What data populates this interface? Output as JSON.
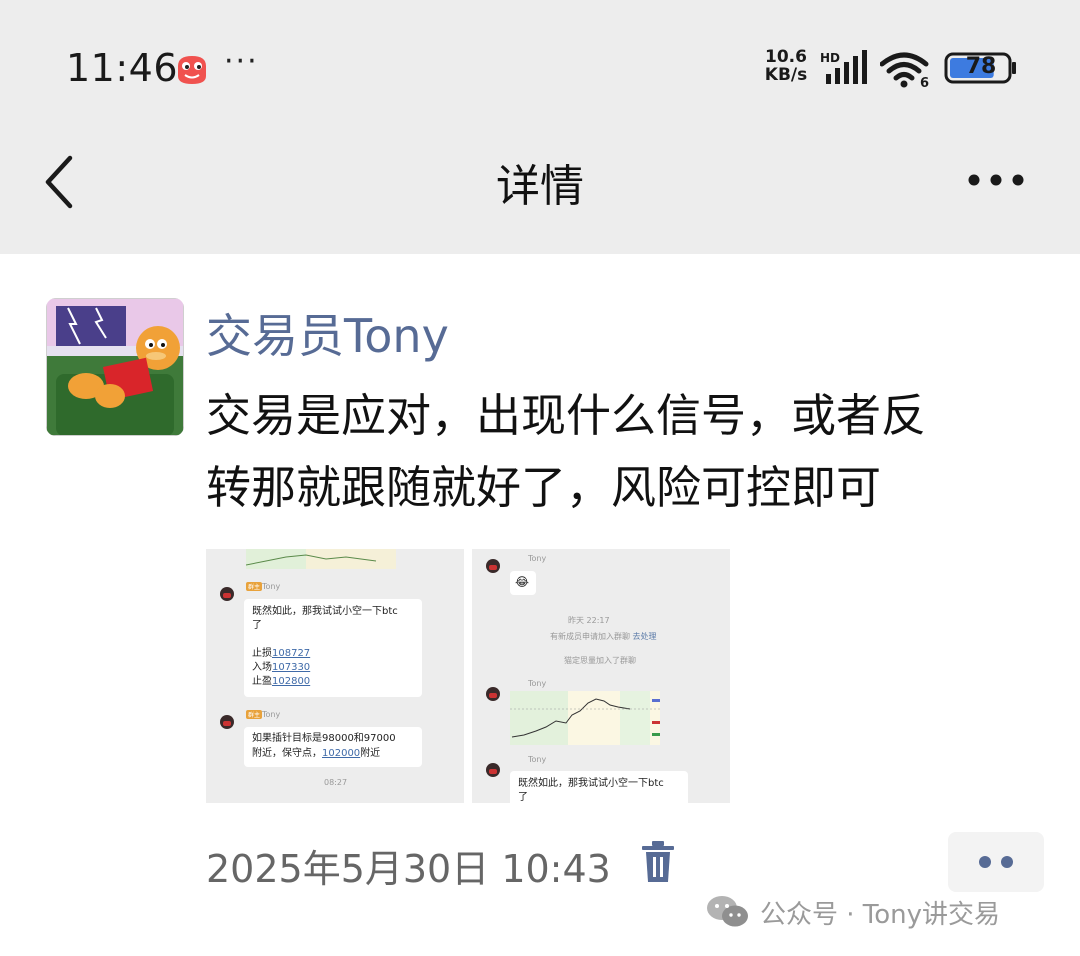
{
  "status_bar": {
    "time": "11:46",
    "overflow": "···",
    "net_speed_value": "10.6",
    "net_speed_unit": "KB/s",
    "signal_label": "HD",
    "wifi_label": "6",
    "battery": "78"
  },
  "header": {
    "title": "详情",
    "back_icon": "chevron-left-icon",
    "more_icon": "more-horizontal-icon"
  },
  "post": {
    "author": "交易员Tony",
    "text_lines": [
      "交易是应对，出现什么信号，或者反",
      "转那就跟随就好了，风险可控即可"
    ],
    "timestamp": "2025年5月30日 10:43",
    "images": [
      {
        "name1": "Tony",
        "tag": "群主",
        "msg1_line1": "既然如此，那我试试小空一下btc",
        "msg1_line2": "了",
        "stop_loss_label": "止损",
        "stop_loss": "108727",
        "entry_label": "入场",
        "entry": "107330",
        "take_profit_label": "止盈",
        "take_profit": "102800",
        "name2": "Tony",
        "msg2_line1": "如果插针目标是98000和97000",
        "msg2_line2_prefix": "附近，保守点，",
        "msg2_value": "102000",
        "msg2_suffix": "附近",
        "time": "08:27"
      },
      {
        "name1": "Tony",
        "emoji": "😂",
        "day_time": "昨天 22:17",
        "notice1": "有新成员申请加入群聊",
        "notice1_link": "去处理",
        "notice2": "猫定思量加入了群聊",
        "name2": "Tony",
        "name3": "Tony",
        "msg_line1": "既然如此，那我试试小空一下btc",
        "msg_line2": "了"
      }
    ]
  },
  "watermark": {
    "text": "公众号 · Tony讲交易"
  },
  "colors": {
    "header_bg": "#ededed",
    "author_link": "#576b95",
    "timestamp": "#666666",
    "battery_fill": "#3d7be0"
  }
}
